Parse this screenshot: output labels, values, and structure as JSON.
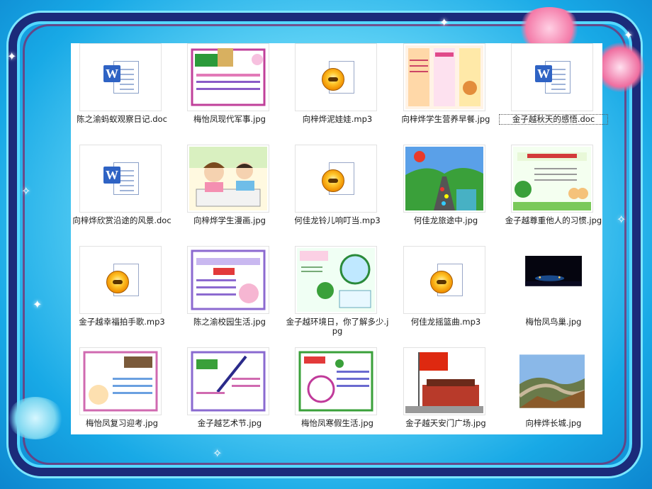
{
  "window": {
    "files": [
      {
        "name": "陈之渝蚂蚁观察日记.doc",
        "type": "doc"
      },
      {
        "name": "梅怡凤现代军事.jpg",
        "type": "jpg",
        "thumb": "poster-pink"
      },
      {
        "name": "向梓烨泥娃娃.mp3",
        "type": "mp3"
      },
      {
        "name": "向梓烨学生营养早餐.jpg",
        "type": "jpg",
        "thumb": "menu"
      },
      {
        "name": "金子越秋天的感悟.doc",
        "type": "doc",
        "selected": true
      },
      {
        "name": "向梓烨欣赏沿途的风景.doc",
        "type": "doc"
      },
      {
        "name": "向梓烨学生漫画.jpg",
        "type": "jpg",
        "thumb": "cartoon"
      },
      {
        "name": "何佳龙铃儿响叮当.mp3",
        "type": "mp3"
      },
      {
        "name": "何佳龙旅途中.jpg",
        "type": "jpg",
        "thumb": "road"
      },
      {
        "name": "金子越尊重他人的习惯.jpg",
        "type": "jpg",
        "thumb": "green-poster"
      },
      {
        "name": "金子越幸福拍手歌.mp3",
        "type": "mp3"
      },
      {
        "name": "陈之渝校园生活.jpg",
        "type": "jpg",
        "thumb": "poster-purple"
      },
      {
        "name": "金子越环境日，你了解多少.jpg",
        "type": "jpg",
        "thumb": "env"
      },
      {
        "name": "何佳龙摇篮曲.mp3",
        "type": "mp3"
      },
      {
        "name": "梅怡凤鸟巢.jpg",
        "type": "jpg",
        "thumb": "night"
      },
      {
        "name": "梅怡凤复习迎考.jpg",
        "type": "jpg",
        "thumb": "poster-blue"
      },
      {
        "name": "金子越艺术节.jpg",
        "type": "jpg",
        "thumb": "poster-art"
      },
      {
        "name": "梅怡凤寒假生活.jpg",
        "type": "jpg",
        "thumb": "poster-holiday"
      },
      {
        "name": "金子越天安门广场.jpg",
        "type": "jpg",
        "thumb": "tiananmen"
      },
      {
        "name": "向梓烨长城.jpg",
        "type": "jpg",
        "thumb": "greatwall"
      }
    ]
  },
  "icons": {
    "doc": "word-document-icon",
    "mp3": "audio-file-icon"
  },
  "colors": {
    "frame": "#1b2b7a",
    "background": "#18a9e6",
    "panel": "#ffffff"
  }
}
